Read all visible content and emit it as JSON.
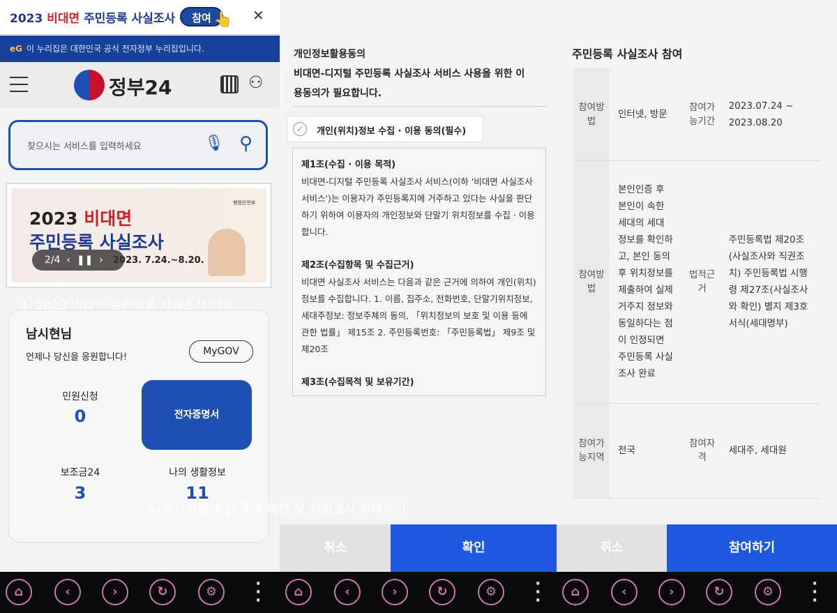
{
  "panel1": {
    "promo": {
      "year": "2023 ",
      "highlight": "비대면",
      "rest": " 주민등록 사실조사",
      "button": "참여",
      "close": "✕"
    },
    "gov_notice": {
      "logo": "eG",
      "text": "이 누리집은 대한민국 공식 전자정부 누리집입니다."
    },
    "header": {
      "logo_text": "정부24"
    },
    "search": {
      "placeholder": "찾으시는 서비스를 입력하세요"
    },
    "banner": {
      "ministry": "행정안전부",
      "line1_year": "2023 ",
      "line1_red": "비대면",
      "line2": "주민등록 사실조사",
      "date": "2023. 7.24.~8.20.",
      "pager": "2/4"
    },
    "caption": "4. 2023 비대면 주민등록 사실조사 터치",
    "card": {
      "name": "남시현님",
      "greeting": "언제나 당신을 응원합니다!",
      "mygov": "MyGOV",
      "stats": [
        {
          "label": "민원신청",
          "value": "0"
        },
        {
          "label": "보조금24",
          "value": "3"
        },
        {
          "label": "나의 생활정보",
          "value": "11"
        }
      ],
      "cert_button": "전자증명서"
    }
  },
  "panel2": {
    "title_line1": "개인정보활용동의",
    "title_line2": "비대면-디지털 주민등록 사실조사 서비스 사용을 위한 이",
    "title_line3": "용동의가 필요합니다.",
    "consent_label": "개인(위치)정보 수집 · 이용 동의(필수)",
    "terms": [
      {
        "heading": "제1조(수집 · 이용 목적)",
        "body": "비대면-디지털 주민등록 사실조사 서비스(이하 '비대면 사실조사 서비스')는 이용자가 주민등록지에 거주하고 있다는 사실을 판단하기 위하여 이용자의 개인정보와 단말기 위치정보를 수집 · 이용합니다."
      },
      {
        "heading": "제2조(수집항목 및 수집근거)",
        "body": "비대면 사실조사 서비스는 다음과 같은 근거에 의하여 개인(위치)정보를 수집합니다. 1. 이름, 집주소, 전화번호, 단말기위치정보, 세대주정보: 정보주체의 동의, 「위치정보의 보호 및 이용 등에 관한 법률」 제15조 2. 주민등록번호: 「주민등록법」 제9조 및 제20조"
      },
      {
        "heading": "제3조(수집목적 및 보유기간)",
        "body": ""
      }
    ],
    "cancel": "취소",
    "confirm": "확인"
  },
  "caption5": "5. 개인정보 수집 동의 확인 및 사실조사 참여하기",
  "panel3": {
    "title": "주민등록 사실조사 참여",
    "rows": [
      {
        "h1": "참여방법",
        "v1": "인터넷, 방문",
        "h2": "참여가능기간",
        "v2": "2023.07.24 ~ 2023.08.20"
      },
      {
        "h1": "참여방법",
        "v1": "본인인증 후 본인이 속한 세대의 세대 정보를 확인하고, 본인 동의 후 위치정보를 제출하여 실제 거주지 정보와 동일하다는 점이 인정되면 주민등록 사실조사 완료",
        "h2": "법적근거",
        "v2": "주민등록법 제20조(사실조사와 직권조치) 주민등록법 시행령 제27조(사실조사와 확인) 별지 제3호서식(세대명부)"
      },
      {
        "h1": "참여가능지역",
        "v1": "전국",
        "h2": "참여자격",
        "v2": "세대주, 세대원"
      }
    ],
    "cancel": "취소",
    "submit": "참여하기"
  },
  "navbar": {
    "icons": [
      "home-icon",
      "back-icon",
      "forward-icon",
      "refresh-icon",
      "settings-icon",
      "more-icon"
    ]
  },
  "colors": {
    "accent": "#1e4fb3",
    "confirm": "#1e58e0",
    "nav_ring": "#cf74b5"
  }
}
